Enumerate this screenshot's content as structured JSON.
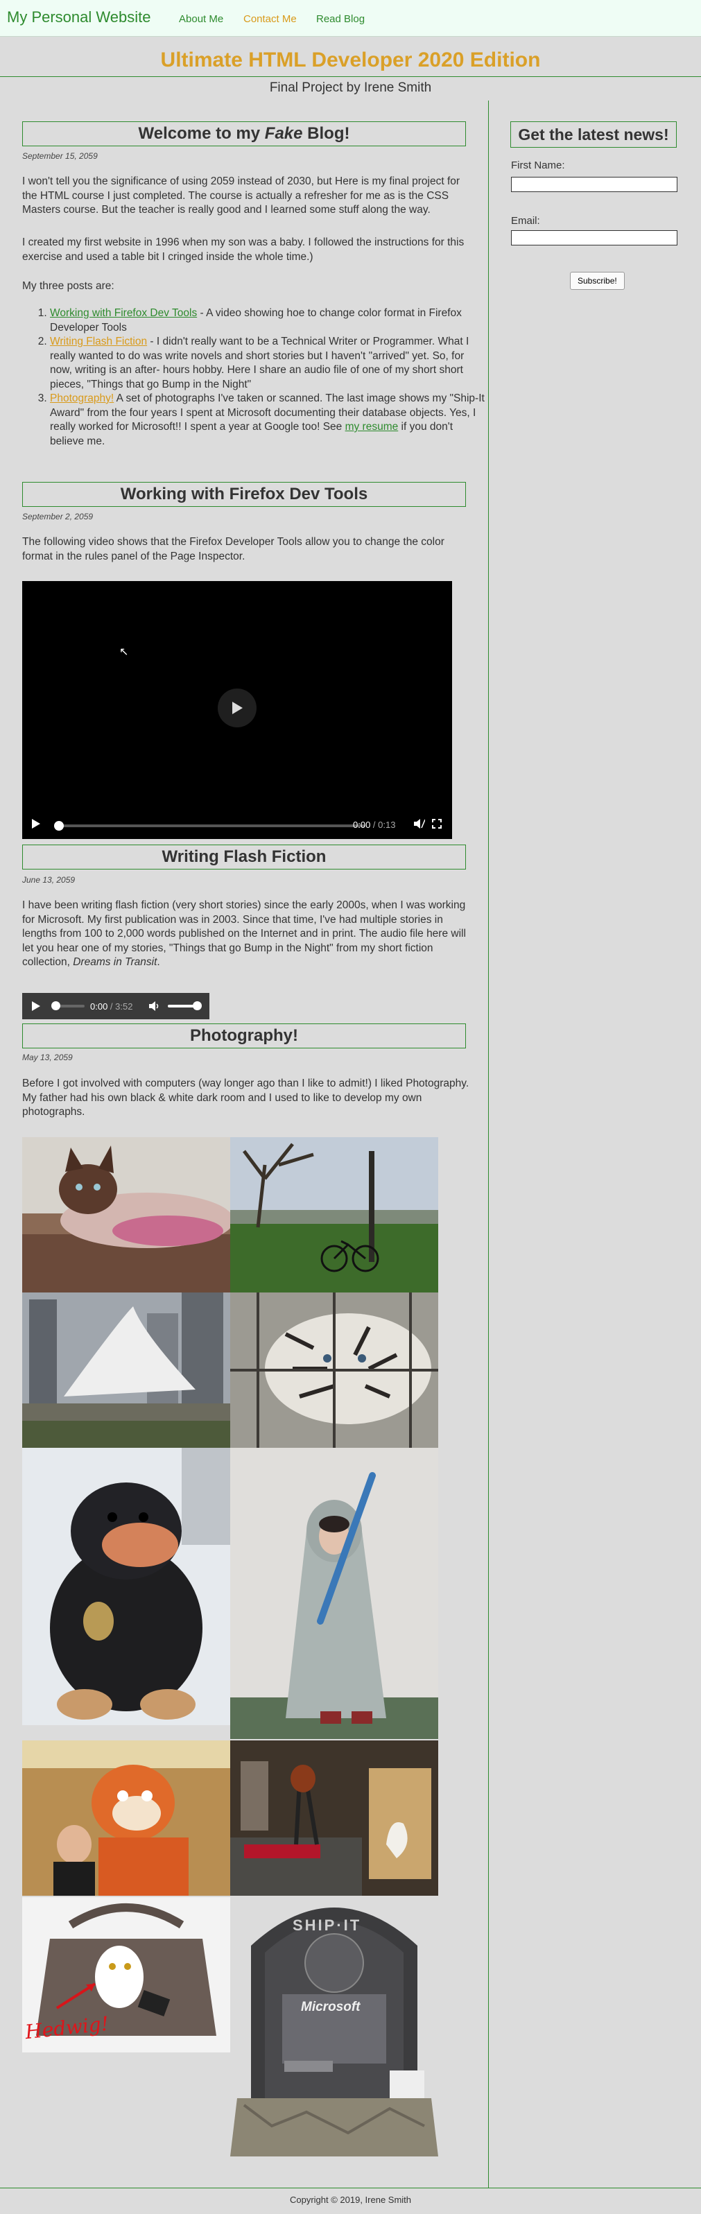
{
  "nav": {
    "brand": "My Personal Website",
    "links": [
      {
        "label": "About Me",
        "color": "#2e8b2e"
      },
      {
        "label": "Contact Me",
        "color": "#d99a1a"
      },
      {
        "label": "Read Blog",
        "color": "#2e8b2e"
      }
    ]
  },
  "header": {
    "title": "Ultimate HTML Developer 2020 Edition",
    "subtitle": "Final Project by Irene Smith"
  },
  "colors": {
    "accent_green": "#2e8b2e",
    "accent_gold": "#daa028",
    "background": "#dcdcdc"
  },
  "posts": [
    {
      "heading_pre": "Welcome to my ",
      "heading_em": "Fake",
      "heading_post": " Blog!",
      "date": "September 15, 2059",
      "paragraphs": [
        "I won't tell you the significance of using 2059 instead of 2030, but Here is my final project for the HTML course I just completed. The course is actually a refresher for me as is the CSS Masters course. But the teacher is really good and I learned some stuff along the way.",
        "I created my first website in 1996 when my son was a baby. I followed the instructions for this exercise and used a table bit I cringed inside the whole time.)",
        "My three posts are:"
      ],
      "list": [
        {
          "link": "Working with Firefox Dev Tools",
          "text": " - A video showing hoe to change color format in Firefox Developer Tools"
        },
        {
          "link": "Writing Flash Fiction",
          "text": " - I didn't really want to be a Technical Writer or Programmer. What I really wanted to do was write novels and short stories but I haven't \"arrived\" yet. So, for now, writing is an after- hours hobby. Here I share an audio file of one of my short short pieces, \"Things that go Bump in the Night\""
        },
        {
          "link": "Photography!",
          "text": " A set of photographs I've taken or scanned. The last image shows my \"Ship-It Award\" from the four years I spent at Microsoft documenting their database objects. Yes, I really worked for Microsoft!! I spent a year at Google too! See ",
          "link2": "my resume",
          "text2": " if you don't believe me."
        }
      ]
    },
    {
      "heading": "Working with Firefox Dev Tools",
      "date": "September 2, 2059",
      "paragraph": "The following video shows that the Firefox Developer Tools allow you to change the color format in the rules panel of the Page Inspector.",
      "video": {
        "time_current": "0:00",
        "time_total": "0:13",
        "progress": 0
      }
    },
    {
      "heading": "Writing Flash Fiction",
      "date": "June 13, 2059",
      "paragraph": "I have been writing flash fiction (very short stories) since the early 2000s, when I was working for Microsoft. My first publication was in 2003. Since that time, I've had multiple stories in lengths from 100 to 2,000 words published on the Internet and in print. The audio file here will let you hear one of my stories, \"Things that go Bump in the Night\" from my short fiction collection, ",
      "paragraph_em": "Dreams in Transit",
      "paragraph_end": ".",
      "audio": {
        "time_current": "0:00",
        "time_total": "3:52",
        "progress": 0,
        "volume": 1
      }
    },
    {
      "heading": "Photography!",
      "date": "May 13, 2059",
      "paragraph": "Before I got involved with computers (way longer ago than I like to admit!) I liked Photography. My father had his own black & white dark room and I used to like to develop my own photographs.",
      "hedwig_caption": "Hedwig!",
      "ship_it": {
        "title": "SHIP·IT",
        "brand": "Microsoft"
      }
    }
  ],
  "sidebar": {
    "heading": "Get the latest news!",
    "first_name_label": "First Name:",
    "email_label": "Email:",
    "subscribe_label": "Subscribe!"
  },
  "footer": "Copyright © 2019, Irene Smith"
}
